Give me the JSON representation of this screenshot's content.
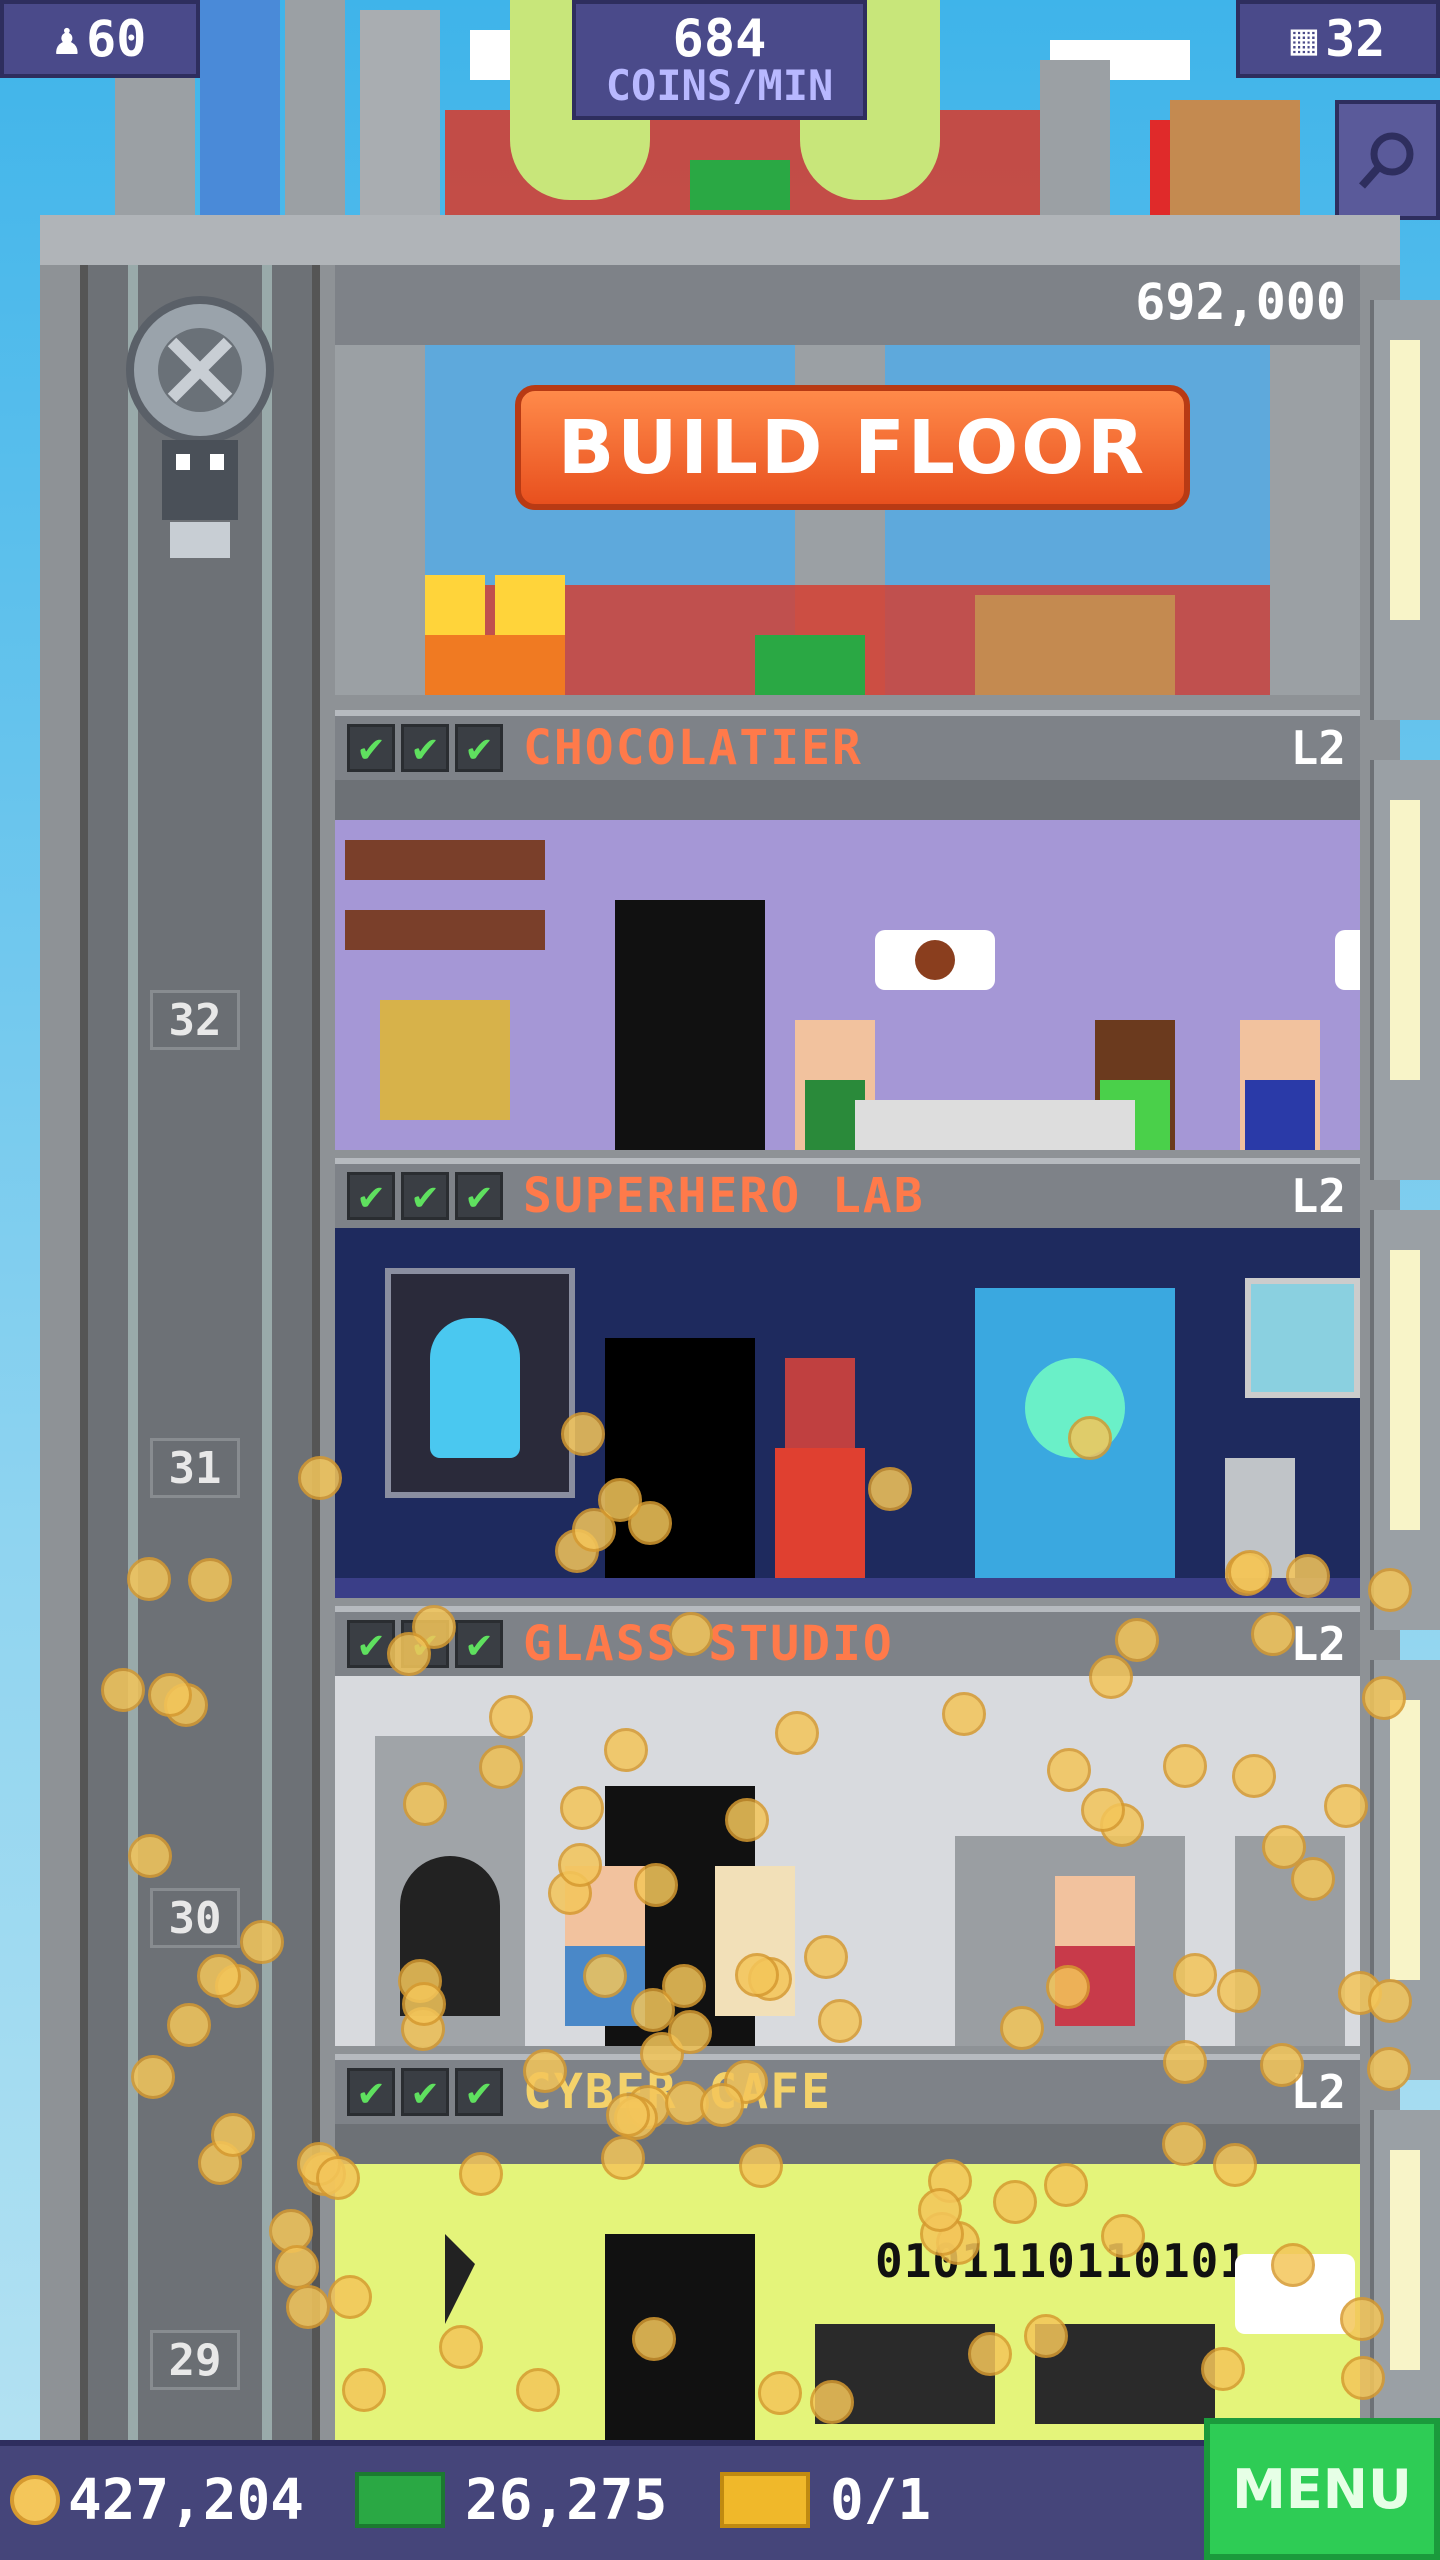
{
  "hud": {
    "population": "60",
    "coins_per_min_value": "684",
    "coins_per_min_unit": "COINS/MIN",
    "floors_count": "32"
  },
  "build_floor": {
    "cost": "692,000",
    "button_label": "BUILD FLOOR"
  },
  "floors": [
    {
      "name": "CHOCOLATIER",
      "level": "L2",
      "number": "32"
    },
    {
      "name": "SUPERHERO LAB",
      "level": "L2",
      "number": "31"
    },
    {
      "name": "GLASS STUDIO",
      "level": "L2",
      "number": "30"
    },
    {
      "name": "CYBER CAFE",
      "level": "L2",
      "number": "29"
    }
  ],
  "checkmark": "✔",
  "cafe_display": "0101110110101",
  "bottom_bar": {
    "coins": "427,204",
    "bux": "26,275",
    "tickets": "0/1",
    "menu_label": "MENU"
  },
  "colors": {
    "hud_bg": "#4a4a8a",
    "floor_name": "#ff7a4a",
    "build_button": "#f06a2e",
    "menu_button": "#2ecc55",
    "coin": "#f4c65a"
  },
  "icons": [
    "person-icon",
    "floors-icon",
    "search-icon",
    "coin-icon",
    "bux-icon",
    "ticket-icon",
    "check-icon"
  ]
}
